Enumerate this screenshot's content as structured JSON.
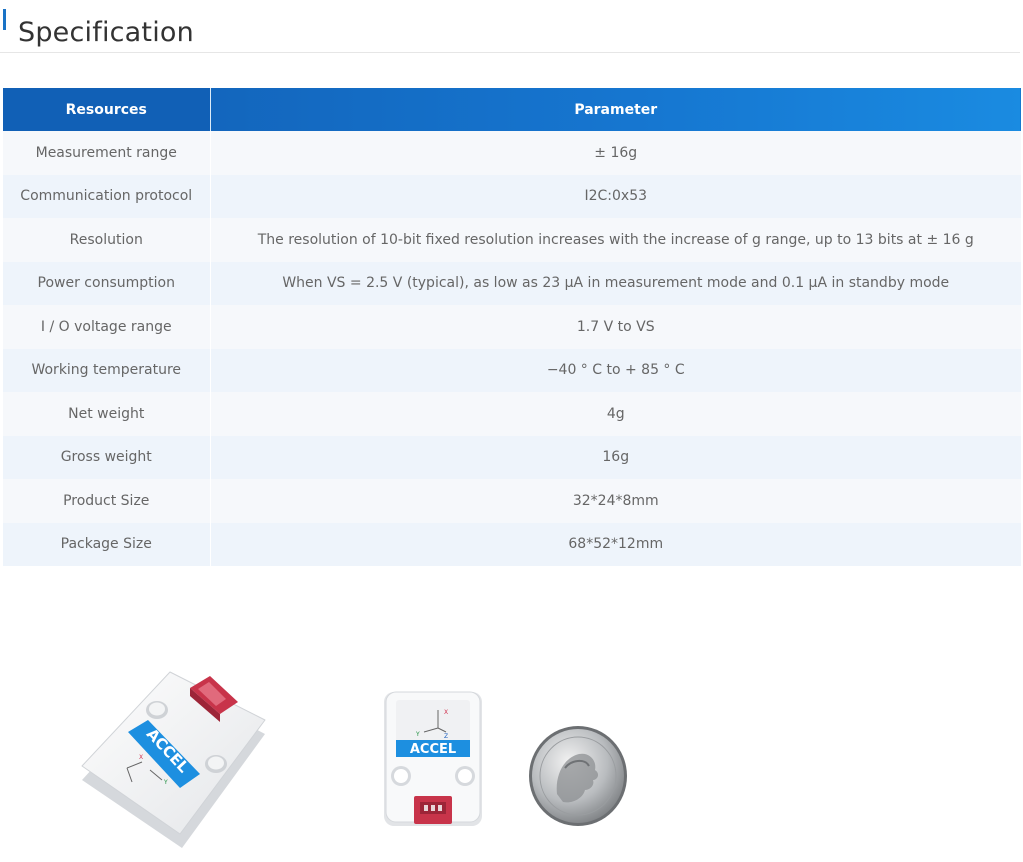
{
  "header": {
    "title": "Specification"
  },
  "table": {
    "columns": [
      "Resources",
      "Parameter"
    ],
    "rows": [
      [
        "Measurement range",
        "± 16g"
      ],
      [
        "Communication protocol",
        "I2C:0x53"
      ],
      [
        "Resolution",
        "The resolution of 10-bit fixed resolution increases with the increase of g range, up to 13 bits at ± 16 g"
      ],
      [
        "Power consumption",
        "When VS = 2.5 V (typical), as low as 23 µA in measurement mode and 0.1 µA in standby mode"
      ],
      [
        "I / O voltage range",
        "1.7 V to VS"
      ],
      [
        "Working temperature",
        "−40 ° C to + 85 ° C"
      ],
      [
        "Net weight",
        "4g"
      ],
      [
        "Gross weight",
        "16g"
      ],
      [
        "Product Size",
        "32*24*8mm"
      ],
      [
        "Package Size",
        "68*52*12mm"
      ]
    ]
  },
  "images": {
    "module_label": "ACCEL",
    "axis_x": "X",
    "axis_y": "Y",
    "axis_z": "Z"
  },
  "colors": {
    "accent": "#1a73c6",
    "header_bg": "#1366bd",
    "label_blue": "#1d8fe0",
    "connector_red": "#c8344a"
  }
}
